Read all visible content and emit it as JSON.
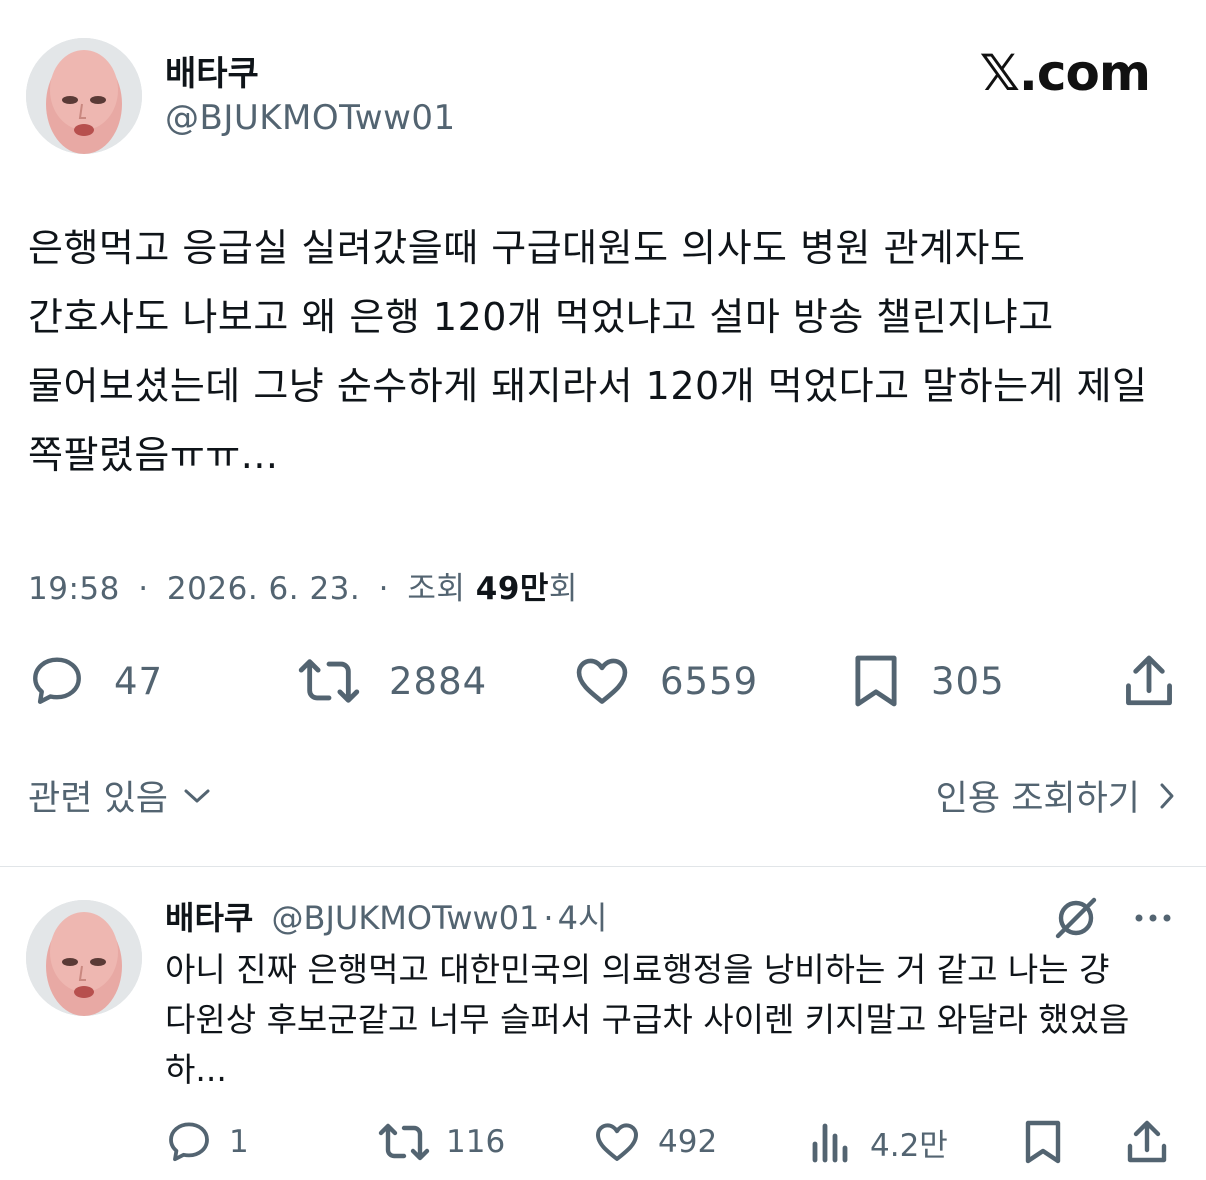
{
  "header": {
    "author_name": "배타쿠",
    "author_handle": "@BJUKMOTww01",
    "watermark": "𝕏.com"
  },
  "tweet": {
    "text": "은행먹고 응급실 실려갔을때 구급대원도 의사도 병원 관계자도 간호사도 나보고 왜 은행 120개 먹었냐고 설마 방송 챌린지냐고 물어보셨는데 그냥 순수하게 돼지라서 120개 먹었다고 말하는게 제일 쪽팔렸음ㅠㅠ...",
    "time": "19:58",
    "date": "2026. 6. 23.",
    "separator": "·",
    "views_label": "조회",
    "views_value": "49만",
    "views_suffix": "회"
  },
  "actions": {
    "reply_count": "47",
    "retweet_count": "2884",
    "like_count": "6559",
    "bookmark_count": "305"
  },
  "footer": {
    "related_label": "관련 있음",
    "quotes_label": "인용 조회하기"
  },
  "reply": {
    "author_name": "배타쿠",
    "author_handle": "@BJUKMOTww01",
    "separator": "·",
    "time": "4시",
    "text": "아니 진짜 은행먹고 대한민국의 의료행정을 낭비하는 거 같고 나는 걍 다윈상 후보군같고 너무 슬퍼서 구급차 사이렌 키지말고 와달라 했었음 하...",
    "reply_count": "1",
    "retweet_count": "116",
    "like_count": "492",
    "view_count": "4.2만"
  },
  "colors": {
    "text_primary": "#0f1419",
    "text_secondary": "#536471",
    "divider": "#e1e5e8",
    "background": "#ffffff"
  },
  "icons": {
    "reply": "speech-bubble-icon",
    "retweet": "retweet-icon",
    "like": "heart-icon",
    "bookmark": "bookmark-icon",
    "share": "share-icon",
    "views": "bar-chart-icon",
    "grok": "grok-icon",
    "more": "more-dots-icon",
    "chevron_down": "chevron-down-icon",
    "chevron_right": "chevron-right-icon"
  }
}
